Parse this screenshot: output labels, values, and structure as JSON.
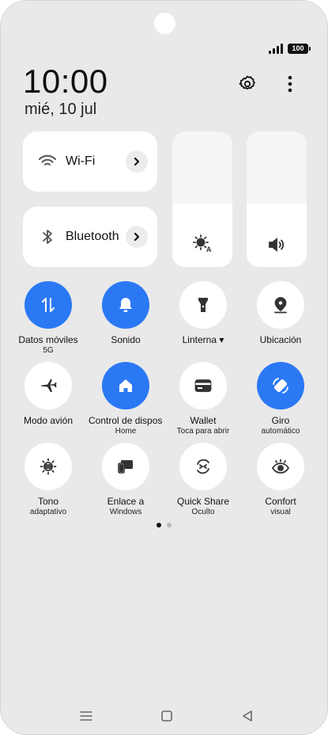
{
  "status": {
    "battery": "100"
  },
  "header": {
    "time": "10:00",
    "date": "mié, 10 jul"
  },
  "tiles": {
    "wifi": {
      "label": "Wi-Fi"
    },
    "bluetooth": {
      "label": "Bluetooth"
    }
  },
  "sliders": {
    "brightness_level": 0.47,
    "volume_level": 0.47
  },
  "quick_settings": [
    {
      "id": "datos",
      "line1": "Datos móviles",
      "line2": "5G",
      "active": true,
      "icon": "data-arrows-icon"
    },
    {
      "id": "sonido",
      "line1": "Sonido",
      "line2": "",
      "active": true,
      "icon": "bell-icon"
    },
    {
      "id": "linterna",
      "line1": "Linterna ▾",
      "line2": "",
      "active": false,
      "icon": "flashlight-icon"
    },
    {
      "id": "ubicacion",
      "line1": "Ubicación",
      "line2": "",
      "active": false,
      "icon": "location-pin-icon"
    },
    {
      "id": "avion",
      "line1": "Modo avión",
      "line2": "",
      "active": false,
      "icon": "airplane-icon"
    },
    {
      "id": "control",
      "line1": "Control de dispositivos",
      "line2": "Home",
      "active": true,
      "icon": "home-icon"
    },
    {
      "id": "wallet",
      "line1": "Wallet",
      "line2": "Toca para abrir",
      "active": false,
      "icon": "card-icon"
    },
    {
      "id": "giro",
      "line1": "Giro",
      "line2": "automático",
      "active": true,
      "icon": "rotate-icon"
    },
    {
      "id": "tono",
      "line1": "Tono",
      "line2": "adaptativo",
      "active": false,
      "icon": "sun-lines-icon"
    },
    {
      "id": "enlace",
      "line1": "Enlace a",
      "line2": "Windows",
      "active": false,
      "icon": "devices-icon"
    },
    {
      "id": "quickshare",
      "line1": "Quick Share",
      "line2": "Oculto",
      "active": false,
      "icon": "quick-share-icon"
    },
    {
      "id": "confort",
      "line1": "Confort",
      "line2": "visual",
      "active": false,
      "icon": "eye-icon"
    }
  ],
  "colors": {
    "accent": "#2b78f5",
    "panel": "#e9e9e9",
    "tile": "#ffffff"
  }
}
